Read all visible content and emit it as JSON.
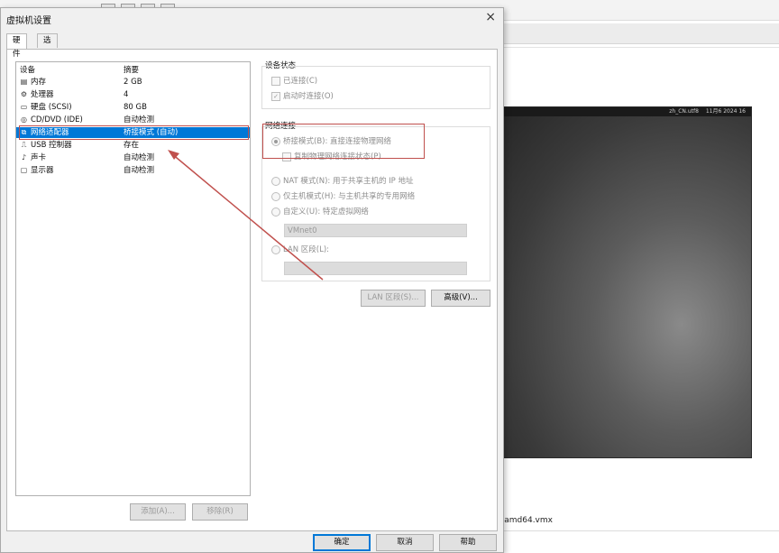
{
  "background": {
    "vm_topbar_items": [
      "zh_CN.utf8",
      "11月6 2024 16"
    ],
    "vmx_file": "-amd64.vmx"
  },
  "dialog": {
    "title": "虚拟机设置",
    "close": "×",
    "tabs": [
      {
        "label": "硬件",
        "active": true
      },
      {
        "label": "选项",
        "active": false
      }
    ],
    "device_list": {
      "col_device": "设备",
      "col_summary": "摘要",
      "rows": [
        {
          "icon": "memory-icon",
          "name": "内存",
          "summary": "2 GB",
          "selected": false
        },
        {
          "icon": "processor-icon",
          "name": "处理器",
          "summary": "4",
          "selected": false
        },
        {
          "icon": "hard-disk-icon",
          "name": "硬盘 (SCSI)",
          "summary": "80 GB",
          "selected": false
        },
        {
          "icon": "cd-dvd-icon",
          "name": "CD/DVD (IDE)",
          "summary": "自动检测",
          "selected": false
        },
        {
          "icon": "network-adapter-icon",
          "name": "网络适配器",
          "summary": "桥接模式 (自动)",
          "selected": true
        },
        {
          "icon": "usb-icon",
          "name": "USB 控制器",
          "summary": "存在",
          "selected": false
        },
        {
          "icon": "sound-icon",
          "name": "声卡",
          "summary": "自动检测",
          "selected": false
        },
        {
          "icon": "display-icon",
          "name": "显示器",
          "summary": "自动检测",
          "selected": false
        }
      ]
    },
    "add_button": "添加(A)...",
    "remove_button": "移除(R)",
    "device_status": {
      "title": "设备状态",
      "connected": "已连接(C)",
      "connect_on_power": "启动时连接(O)"
    },
    "network": {
      "title": "网络连接",
      "bridged": "桥接模式(B): 直接连接物理网络",
      "replicate": "复制物理网络连接状态(P)",
      "nat": "NAT 模式(N): 用于共享主机的 IP 地址",
      "host_only": "仅主机模式(H): 与主机共享的专用网络",
      "custom": "自定义(U): 特定虚拟网络",
      "custom_value": "VMnet0",
      "lan": "LAN 区段(L):",
      "lan_value": ""
    },
    "lan_segments_button": "LAN 区段(S)...",
    "advanced_button": "高级(V)...",
    "ok_button": "确定",
    "cancel_button": "取消",
    "help_button": "帮助"
  },
  "colors": {
    "selection": "#0078d7",
    "highlight_annotation": "#c0504d"
  }
}
